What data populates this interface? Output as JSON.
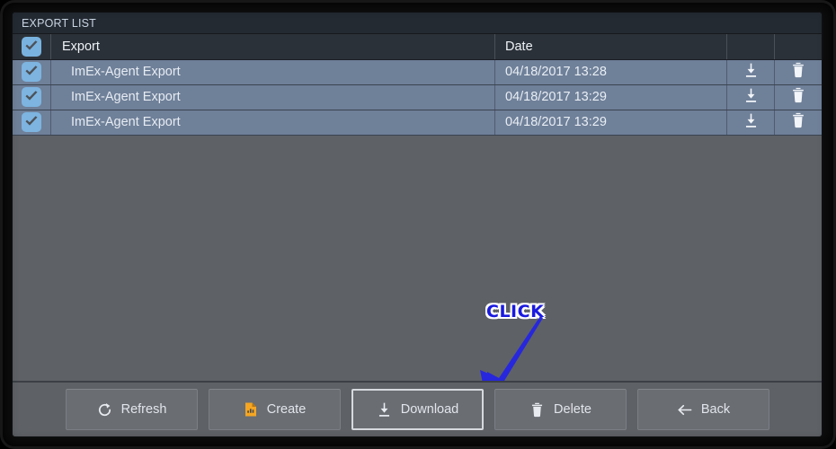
{
  "window": {
    "title": "EXPORT LIST"
  },
  "table": {
    "columns": [
      {
        "key": "select",
        "label": "",
        "icon": "checkbox-checked-icon"
      },
      {
        "key": "export",
        "label": "Export"
      },
      {
        "key": "date",
        "label": "Date"
      },
      {
        "key": "download",
        "label": "",
        "icon": "download-icon"
      },
      {
        "key": "delete",
        "label": "",
        "icon": "trash-icon"
      }
    ],
    "header_checkbox_checked": true,
    "rows": [
      {
        "selected": true,
        "export": "ImEx-Agent Export",
        "date": "04/18/2017 13:28",
        "download_icon": "download-icon",
        "delete_icon": "trash-icon"
      },
      {
        "selected": true,
        "export": "ImEx-Agent Export",
        "date": "04/18/2017 13:29",
        "download_icon": "download-icon",
        "delete_icon": "trash-icon"
      },
      {
        "selected": true,
        "export": "ImEx-Agent Export",
        "date": "04/18/2017 13:29",
        "download_icon": "download-icon",
        "delete_icon": "trash-icon"
      }
    ]
  },
  "annotation": {
    "label": "CLICK",
    "text_color": "#1a1ae0",
    "outline_color": "#ffffff",
    "arrow_color": "#2727dd",
    "points_to": "download-button"
  },
  "toolbar": {
    "buttons": [
      {
        "id": "refresh",
        "label": "Refresh",
        "icon": "refresh-icon",
        "focused": false
      },
      {
        "id": "create",
        "label": "Create",
        "icon": "create-report-icon",
        "focused": false
      },
      {
        "id": "download",
        "label": "Download",
        "icon": "download-icon",
        "focused": true
      },
      {
        "id": "delete",
        "label": "Delete",
        "icon": "trash-icon",
        "focused": false
      },
      {
        "id": "back",
        "label": "Back",
        "icon": "arrow-left-icon",
        "focused": false
      }
    ]
  },
  "colors": {
    "frame": "#0d0d0d",
    "window_bg": "#5e6166",
    "titlebar_bg": "#242a32",
    "titlebar_text": "#c8d4e2",
    "table_header_bg": "#2b3138",
    "row_selected_bg": "#6f8099",
    "checkbox_bg": "#7db4e0",
    "create_icon": "#f5a623",
    "button_bg": "#6a6d72",
    "focus_border": "#d6dade"
  }
}
